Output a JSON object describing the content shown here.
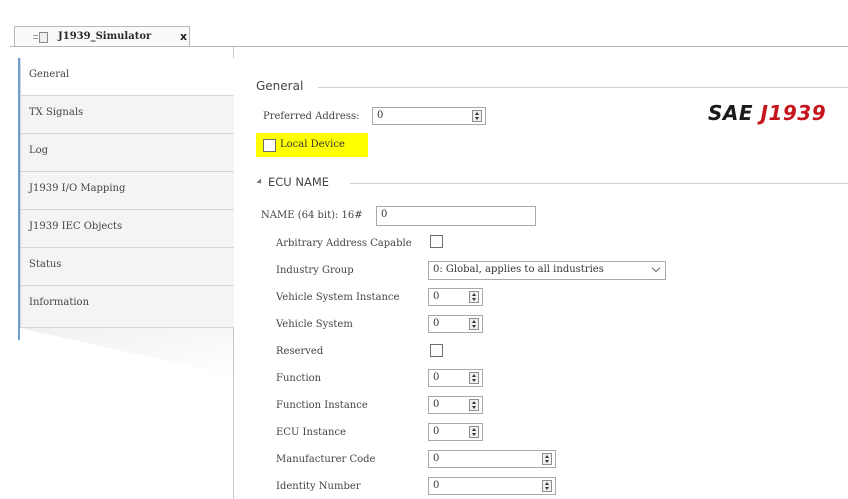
{
  "document_tab": {
    "title": "J1939_Simulator",
    "close_glyph": "x",
    "icon": "document-icon"
  },
  "nav": {
    "items": [
      {
        "label": "General",
        "selected": true
      },
      {
        "label": "TX Signals",
        "selected": false
      },
      {
        "label": "Log",
        "selected": false
      },
      {
        "label": "J1939 I/O Mapping",
        "selected": false
      },
      {
        "label": "J1939 IEC Objects",
        "selected": false
      },
      {
        "label": "Status",
        "selected": false
      },
      {
        "label": "Information",
        "selected": false
      }
    ]
  },
  "general": {
    "section_title": "General",
    "preferred_address_label": "Preferred Address:",
    "preferred_address_value": "0",
    "local_device_label": "Local Device",
    "local_device_checked": false
  },
  "logo": {
    "prefix": "SAE",
    "suffix": "J1939",
    "prefix_color": "#1a1a1a",
    "suffix_color": "#c4161c"
  },
  "ecu_name": {
    "section_title": "ECU NAME",
    "name_label": "NAME (64 bit): 16#",
    "name_value": "0",
    "arbitrary_address_capable_label": "Arbitrary Address Capable",
    "industry_group_label": "Industry Group",
    "industry_group_value": "0: Global, applies to all industries",
    "vehicle_system_instance_label": "Vehicle System Instance",
    "vehicle_system_instance_value": "0",
    "vehicle_system_label": "Vehicle System",
    "vehicle_system_value": "0",
    "reserved_label": "Reserved",
    "function_label": "Function",
    "function_value": "0",
    "function_instance_label": "Function Instance",
    "function_instance_value": "0",
    "ecu_instance_label": "ECU Instance",
    "ecu_instance_value": "0",
    "manufacturer_code_label": "Manufacturer Code",
    "manufacturer_code_value": "0",
    "identity_number_label": "Identity Number",
    "identity_number_value": "0"
  },
  "colors": {
    "highlight": "#ffff00",
    "nav_accent": "#6f9ed3"
  }
}
